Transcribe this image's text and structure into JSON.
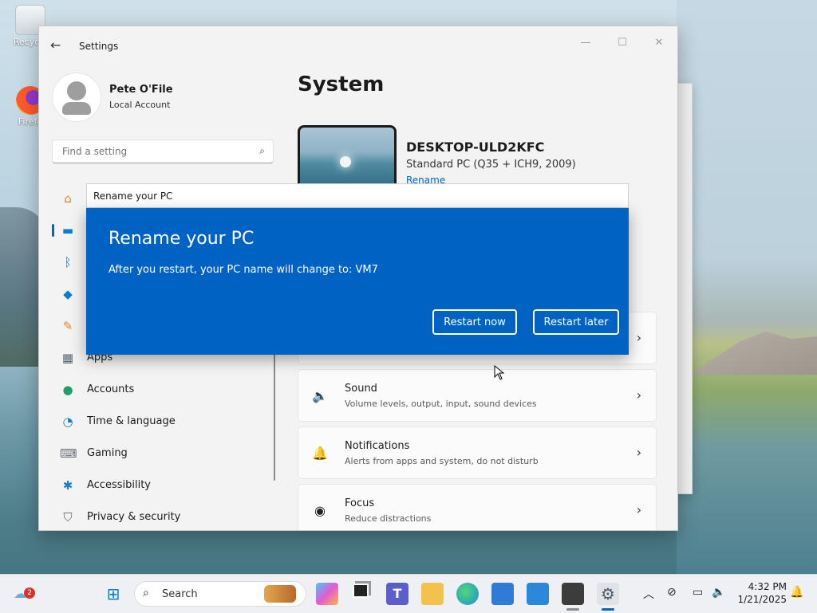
{
  "desktop": {
    "icons": [
      {
        "label": "Recycle"
      },
      {
        "label": "Firefo"
      }
    ]
  },
  "window": {
    "title": "Settings",
    "controls": {
      "minimize": "—",
      "maximize": "☐",
      "close": "✕"
    }
  },
  "profile": {
    "name": "Pete O'File",
    "account_type": "Local Account"
  },
  "search": {
    "placeholder": "Find a setting"
  },
  "nav": {
    "items": [
      {
        "label": "",
        "icon": "home-icon"
      },
      {
        "label": "",
        "icon": "system-icon"
      },
      {
        "label": "",
        "icon": "bluetooth-icon"
      },
      {
        "label": "",
        "icon": "wifi-icon"
      },
      {
        "label": "",
        "icon": "brush-icon"
      },
      {
        "label": "Apps",
        "icon": "apps-icon"
      },
      {
        "label": "Accounts",
        "icon": "accounts-icon"
      },
      {
        "label": "Time & language",
        "icon": "globe-clock-icon"
      },
      {
        "label": "Gaming",
        "icon": "gamepad-icon"
      },
      {
        "label": "Accessibility",
        "icon": "accessibility-icon"
      },
      {
        "label": "Privacy & security",
        "icon": "shield-icon"
      }
    ]
  },
  "content": {
    "title": "System",
    "device": {
      "name": "DESKTOP-ULD2KFC",
      "model": "Standard PC (Q35 + ICH9, 2009)",
      "rename_link": "Rename"
    },
    "cards": [
      {
        "title": "Sound",
        "subtitle": "Volume levels, output, input, sound devices",
        "icon": "speaker-icon"
      },
      {
        "title": "Notifications",
        "subtitle": "Alerts from apps and system, do not disturb",
        "icon": "bell-icon"
      },
      {
        "title": "Focus",
        "subtitle": "Reduce distractions",
        "icon": "focus-icon"
      }
    ]
  },
  "dialog": {
    "window_title": "Rename your PC",
    "heading": "Rename your PC",
    "message": "After you restart, your PC name will change to: VM7",
    "restart_now": "Restart now",
    "restart_later": "Restart later"
  },
  "taskbar": {
    "search_label": "Search",
    "weather_badge": "2",
    "time": "4:32 PM",
    "date": "1/21/2025"
  },
  "colors": {
    "accent": "#0067c0",
    "dialog_bg": "#0063c4"
  }
}
